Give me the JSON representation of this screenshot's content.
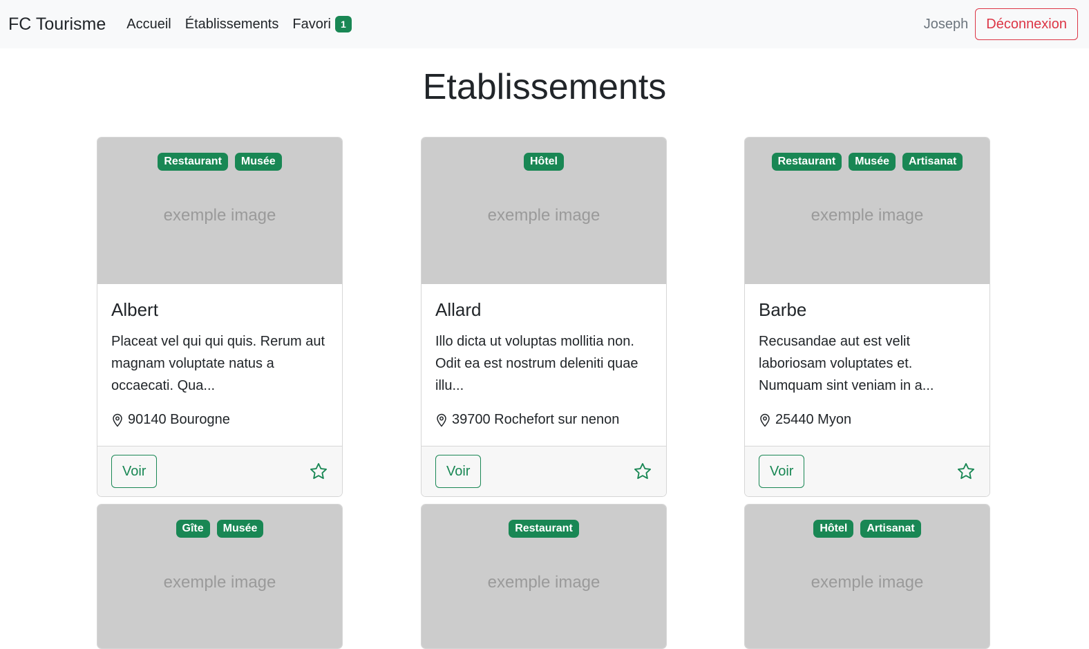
{
  "navbar": {
    "brand": "FC Tourisme",
    "links": [
      "Accueil",
      "Établissements",
      "Favori"
    ],
    "favori_count": "1",
    "username": "Joseph",
    "logout_label": "Déconnexion"
  },
  "page_title": "Etablissements",
  "placeholder_text": "exemple image",
  "voir_label": "Voir",
  "accent_color": "#198754",
  "danger_color": "#dc3545",
  "cards": [
    {
      "tags": [
        "Restaurant",
        "Musée"
      ],
      "name": "Albert",
      "description": "Placeat vel qui qui quis. Rerum aut magnam voluptate natus a occaecati. Qua...",
      "location": "90140 Bourogne"
    },
    {
      "tags": [
        "Hôtel"
      ],
      "name": "Allard",
      "description": "Illo dicta ut voluptas mollitia non. Odit ea est nostrum deleniti quae illu...",
      "location": "39700 Rochefort sur nenon"
    },
    {
      "tags": [
        "Restaurant",
        "Musée",
        "Artisanat"
      ],
      "name": "Barbe",
      "description": "Recusandae aut est velit laboriosam voluptates et. Numquam sint veniam in a...",
      "location": "25440 Myon"
    },
    {
      "tags": [
        "Gîte",
        "Musée"
      ]
    },
    {
      "tags": [
        "Restaurant"
      ]
    },
    {
      "tags": [
        "Hôtel",
        "Artisanat"
      ]
    }
  ]
}
